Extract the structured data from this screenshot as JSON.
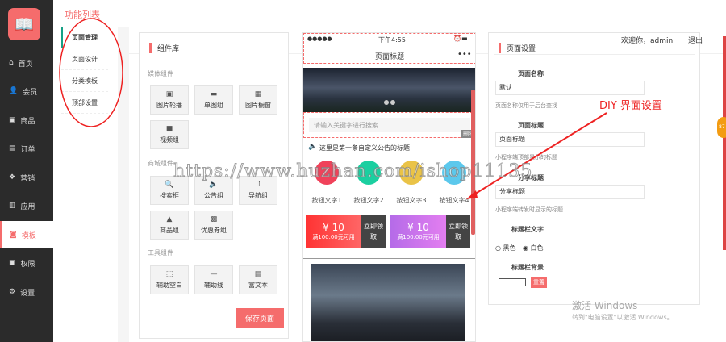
{
  "sidebar": {
    "items": [
      {
        "label": "首页",
        "icon": "home-icon"
      },
      {
        "label": "会员",
        "icon": "user-icon"
      },
      {
        "label": "商品",
        "icon": "gift-icon"
      },
      {
        "label": "订单",
        "icon": "clipboard-icon"
      },
      {
        "label": "营销",
        "icon": "gift-box-icon"
      },
      {
        "label": "应用",
        "icon": "bank-icon"
      },
      {
        "label": "模板",
        "icon": "camera-icon"
      },
      {
        "label": "权限",
        "icon": "id-badge-icon"
      },
      {
        "label": "设置",
        "icon": "gear-icon"
      }
    ]
  },
  "subnav": {
    "title": "功能列表",
    "items": [
      "页面管理",
      "页面设计",
      "分类模板",
      "顶部设置"
    ]
  },
  "header": {
    "welcome": "欢迎你，admin",
    "logout": "退出"
  },
  "library": {
    "title": "组件库",
    "sections": [
      {
        "title": "媒体组件",
        "items": [
          "图片轮播",
          "单图组",
          "图片橱窗",
          "视频组"
        ]
      },
      {
        "title": "商城组件",
        "items": [
          "搜索框",
          "公告组",
          "导航组",
          "商品组",
          "优惠券组"
        ]
      },
      {
        "title": "工具组件",
        "items": [
          "辅助空白",
          "辅助线",
          "富文本"
        ]
      }
    ],
    "save": "保存页面"
  },
  "phone": {
    "signal": "●●●●●",
    "time": "下午4:55",
    "title": "页面标题",
    "more": "•••",
    "search_placeholder": "请输入关键字进行搜索",
    "delete": "删除",
    "notice": "这里是第一条自定义公告的标题",
    "nav": [
      "按钮文字1",
      "按钮文字2",
      "按钮文字3",
      "按钮文字4"
    ],
    "nav_colors": [
      "#f0425a",
      "#1bcfa0",
      "#eac347",
      "#5cc8ec"
    ],
    "coupons": [
      {
        "amount": "¥ 10",
        "cond": "满100.00元可用",
        "action": "立即领取"
      },
      {
        "amount": "¥ 10",
        "cond": "满100.00元可用",
        "action": "立即领取"
      }
    ]
  },
  "settings": {
    "title": "页面设置",
    "name_label": "页面名称",
    "name_value": "默认",
    "name_hint": "页面名称仅用于后台查找",
    "title_label": "页面标题",
    "title_value": "页面标题",
    "title_hint": "小程序端顶部显示的标题",
    "share_label": "分享标题",
    "share_value": "分享标题",
    "share_hint": "小程序端转发时显示的标题",
    "textcolor_label": "标题栏文字",
    "opt_black": "黑色",
    "opt_white": "白色",
    "bg_label": "标题栏背景",
    "reset": "重置"
  },
  "annotation": {
    "text": "DIY 界面设置",
    "watermark": "https://www.huzhan.com/ishop11135"
  },
  "os": {
    "activate_title": "激活 Windows",
    "activate_sub": "转到\"电脑设置\"以激活 Windows。",
    "badge": "87"
  }
}
